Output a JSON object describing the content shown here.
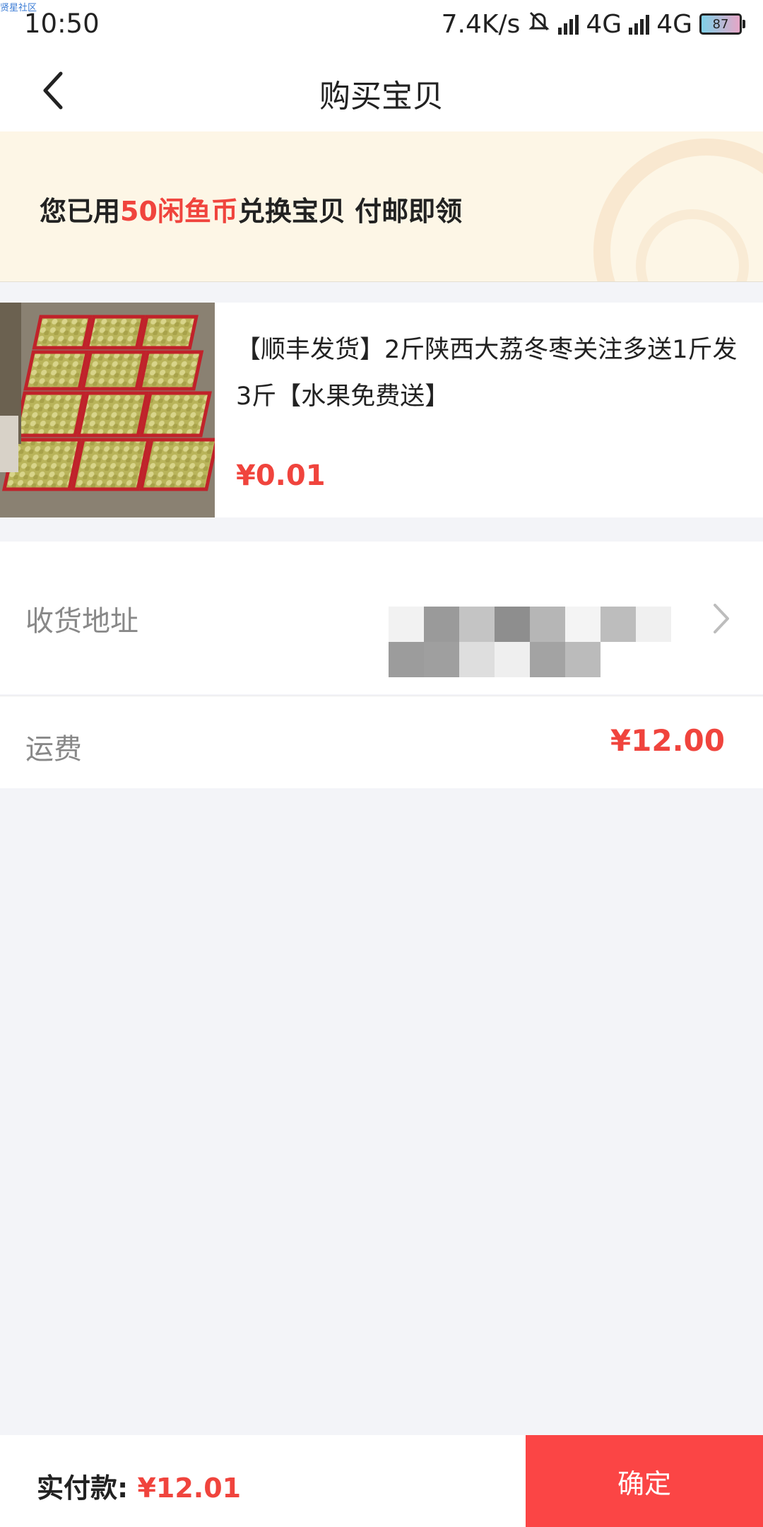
{
  "status_bar": {
    "watermark": "贤星社区",
    "time": "10:50",
    "net_speed": "7.4K/s",
    "sim1_label": "4G",
    "sim2_label": "4G",
    "battery": "87"
  },
  "nav": {
    "title": "购买宝贝"
  },
  "banner": {
    "prefix": "您已用",
    "highlight": "50闲鱼币",
    "suffix": "兑换宝贝 付邮即领"
  },
  "product": {
    "title": "【顺丰发货】2斤陕西大荔冬枣关注多送1斤发3斤【水果免费送】",
    "price": "¥0.01"
  },
  "address": {
    "label": "收货地址"
  },
  "shipping": {
    "label": "运费",
    "value": "¥12.00"
  },
  "bottom": {
    "pay_label": "实付款:",
    "pay_amount": "¥12.01",
    "confirm_label": "确定"
  },
  "colors": {
    "accent_red": "#f0443d",
    "button_red": "#fb4545",
    "banner_bg": "#fdf6e6",
    "page_bg": "#f3f4f8"
  }
}
